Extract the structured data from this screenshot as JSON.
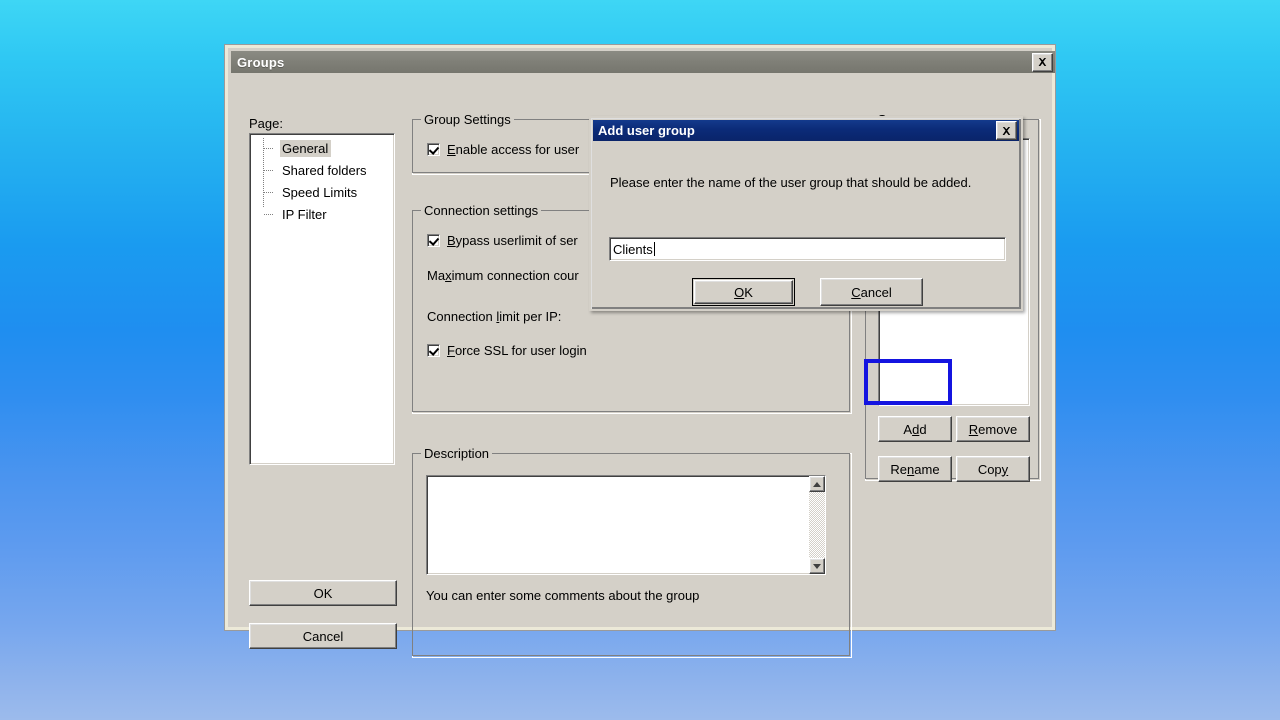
{
  "window": {
    "title": "Groups",
    "close_label": "✕"
  },
  "sidebar": {
    "page_label": "Page:",
    "items": [
      {
        "label": "General",
        "selected": true
      },
      {
        "label": "Shared folders",
        "selected": false
      },
      {
        "label": "Speed Limits",
        "selected": false
      },
      {
        "label": "IP Filter",
        "selected": false
      }
    ]
  },
  "group_settings": {
    "legend": "Group Settings",
    "enable_access": {
      "label_pre": "",
      "label_accel": "E",
      "label_post": "nable access for user",
      "checked": true
    }
  },
  "connection_settings": {
    "legend": "Connection settings",
    "bypass_userlimit": {
      "label_pre": "",
      "label_accel": "B",
      "label_post": "ypass userlimit of ser",
      "checked": true
    },
    "max_connection_count": {
      "label_pre": "Ma",
      "label_accel": "x",
      "label_post": "imum connection cour"
    },
    "connection_limit_per_ip": {
      "label_pre": "Connection ",
      "label_accel": "l",
      "label_post": "imit per IP:"
    },
    "force_ssl": {
      "label_pre": "",
      "label_accel": "F",
      "label_post": "orce SSL for user login",
      "checked": true
    }
  },
  "description": {
    "legend": "Description",
    "value": "",
    "hint": "You can enter some comments about the group"
  },
  "groups_panel": {
    "legend_pre": "",
    "legend_accel": "G",
    "legend_post": "roups",
    "list_items": [],
    "buttons": {
      "add": {
        "pre": "A",
        "accel": "d",
        "post": "d",
        "highlighted": true
      },
      "remove": {
        "pre": "",
        "accel": "R",
        "post": "emove"
      },
      "rename": {
        "pre": "Re",
        "accel": "n",
        "post": "ame"
      },
      "copy": {
        "pre": "Cop",
        "accel": "y",
        "post": ""
      }
    }
  },
  "footer": {
    "ok_label": "OK",
    "cancel_label": "Cancel"
  },
  "dialog": {
    "title": "Add user group",
    "close_label": "✕",
    "message": "Please enter the name of the user group that should be added.",
    "input": {
      "value": "Clients",
      "placeholder": ""
    },
    "ok": {
      "pre": "",
      "accel": "O",
      "post": "K"
    },
    "cancel": {
      "pre": "",
      "accel": "C",
      "post": "ancel"
    }
  },
  "colors": {
    "face": "#d4d0c8",
    "dialog_titlebar": "#0a246a",
    "window_titlebar": "#7f7f77",
    "highlight_annotation": "#1414e0"
  }
}
